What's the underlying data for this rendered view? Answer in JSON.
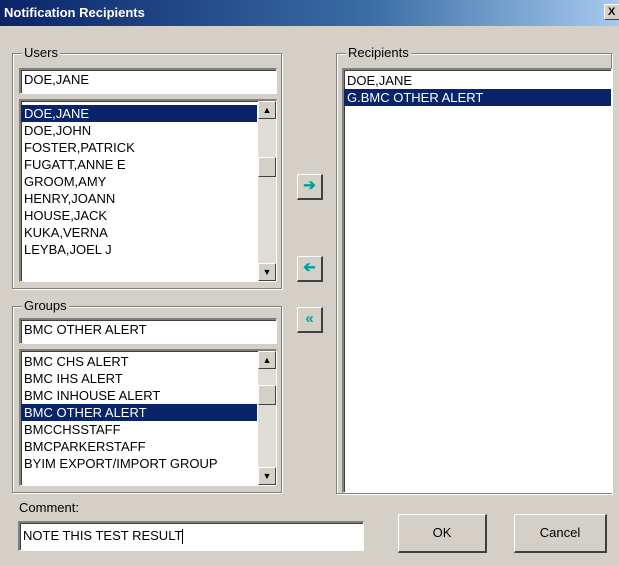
{
  "window": {
    "title": "Notification Recipients",
    "close_glyph": "X"
  },
  "users": {
    "group_label": "Users",
    "search_value": "DOE,JANE",
    "items": [
      {
        "label": "DOE,JANE",
        "selected": true
      },
      {
        "label": "DOE,JOHN",
        "selected": false
      },
      {
        "label": "FOSTER,PATRICK",
        "selected": false
      },
      {
        "label": "FUGATT,ANNE E",
        "selected": false
      },
      {
        "label": "GROOM,AMY",
        "selected": false
      },
      {
        "label": "HENRY,JOANN",
        "selected": false
      },
      {
        "label": "HOUSE,JACK",
        "selected": false
      },
      {
        "label": "KUKA,VERNA",
        "selected": false
      },
      {
        "label": "LEYBA,JOEL J",
        "selected": false
      }
    ]
  },
  "groups": {
    "group_label": "Groups",
    "search_value": "BMC OTHER ALERT",
    "items": [
      {
        "label": "BMC CHS ALERT",
        "selected": false
      },
      {
        "label": "BMC IHS ALERT",
        "selected": false
      },
      {
        "label": "BMC INHOUSE ALERT",
        "selected": false
      },
      {
        "label": "BMC OTHER ALERT",
        "selected": true
      },
      {
        "label": "BMCCHSSTAFF",
        "selected": false
      },
      {
        "label": "BMCPARKERSTAFF",
        "selected": false
      },
      {
        "label": "BYIM EXPORT/IMPORT GROUP",
        "selected": false
      }
    ]
  },
  "recipients": {
    "group_label": "Recipients",
    "items": [
      {
        "label": "DOE,JANE",
        "selected": false
      },
      {
        "label": "G.BMC OTHER ALERT",
        "selected": true
      }
    ]
  },
  "transfer": {
    "add_icon": "right-arrow-icon",
    "remove_icon": "left-arrow-icon",
    "remove_all_icon": "double-left-arrow-icon"
  },
  "comment": {
    "label": "Comment:",
    "value": "NOTE THIS TEST RESULT"
  },
  "buttons": {
    "ok_label": "OK",
    "cancel_label": "Cancel"
  },
  "colors": {
    "selection": "#0a246a",
    "arrow": "#00a0a0",
    "face": "#d4d0c8"
  }
}
